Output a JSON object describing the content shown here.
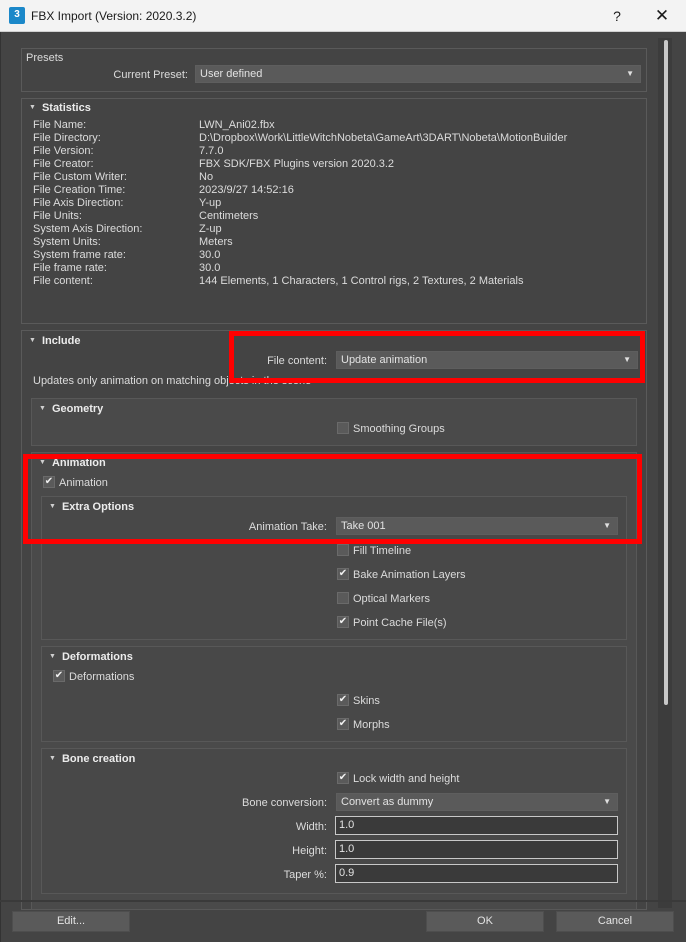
{
  "window": {
    "title": "FBX Import (Version: 2020.3.2)",
    "app_icon_text": "3",
    "help_glyph": "?",
    "close_glyph": "✕"
  },
  "presets": {
    "header": "Presets",
    "current_preset_label": "Current Preset:",
    "current_preset_value": "User defined"
  },
  "statistics": {
    "header": "Statistics",
    "rows": [
      {
        "key": "File Name:",
        "value": "LWN_Ani02.fbx"
      },
      {
        "key": "File Directory:",
        "value": "D:\\Dropbox\\Work\\LittleWitchNobeta\\GameArt\\3DART\\Nobeta\\MotionBuilder"
      },
      {
        "key": "File Version:",
        "value": "7.7.0"
      },
      {
        "key": "File Creator:",
        "value": "FBX SDK/FBX Plugins version 2020.3.2"
      },
      {
        "key": "File Custom Writer:",
        "value": "No"
      },
      {
        "key": "File Creation Time:",
        "value": "2023/9/27  14:52:16"
      },
      {
        "key": "File Axis Direction:",
        "value": "Y-up"
      },
      {
        "key": "File Units:",
        "value": "Centimeters"
      },
      {
        "key": "System Axis Direction:",
        "value": "Z-up"
      },
      {
        "key": "System Units:",
        "value": "Meters"
      },
      {
        "key": "System frame rate:",
        "value": "30.0"
      },
      {
        "key": "File frame rate:",
        "value": "30.0"
      },
      {
        "key": "File content:",
        "value": "144 Elements,    1 Characters,    1 Control rigs,    2 Textures,    2 Materials"
      }
    ]
  },
  "include": {
    "header": "Include",
    "file_content_label": "File content:",
    "file_content_value": "Update animation",
    "description": "Updates only animation on matching objects in the scene"
  },
  "geometry": {
    "header": "Geometry",
    "smoothing_groups": {
      "label": "Smoothing Groups",
      "checked": false
    }
  },
  "animation": {
    "header": "Animation",
    "animation_checkbox": {
      "label": "Animation",
      "checked": true
    },
    "extra_options": {
      "header": "Extra Options",
      "take_label": "Animation Take:",
      "take_value": "Take 001",
      "fill_timeline": {
        "label": "Fill Timeline",
        "checked": false
      },
      "bake_layers": {
        "label": "Bake Animation Layers",
        "checked": true
      },
      "optical_markers": {
        "label": "Optical Markers",
        "checked": false
      },
      "point_cache": {
        "label": "Point Cache File(s)",
        "checked": true
      }
    },
    "deformations": {
      "header": "Deformations",
      "deformations_checkbox": {
        "label": "Deformations",
        "checked": true
      },
      "skins": {
        "label": "Skins",
        "checked": true
      },
      "morphs": {
        "label": "Morphs",
        "checked": true
      }
    },
    "bone_creation": {
      "header": "Bone creation",
      "lock": {
        "label": "Lock width and height",
        "checked": true
      },
      "conversion_label": "Bone conversion:",
      "conversion_value": "Convert as dummy",
      "width_label": "Width:",
      "width_value": "1.0",
      "height_label": "Height:",
      "height_value": "1.0",
      "taper_label": "Taper %:",
      "taper_value": "0.9"
    }
  },
  "buttons": {
    "edit": "Edit...",
    "ok": "OK",
    "cancel": "Cancel"
  },
  "glyphs": {
    "check": "✔",
    "collapse": "▼",
    "dropdown": "▼"
  },
  "colors": {
    "highlight": "#ff0000",
    "dialog_bg": "#444444"
  }
}
